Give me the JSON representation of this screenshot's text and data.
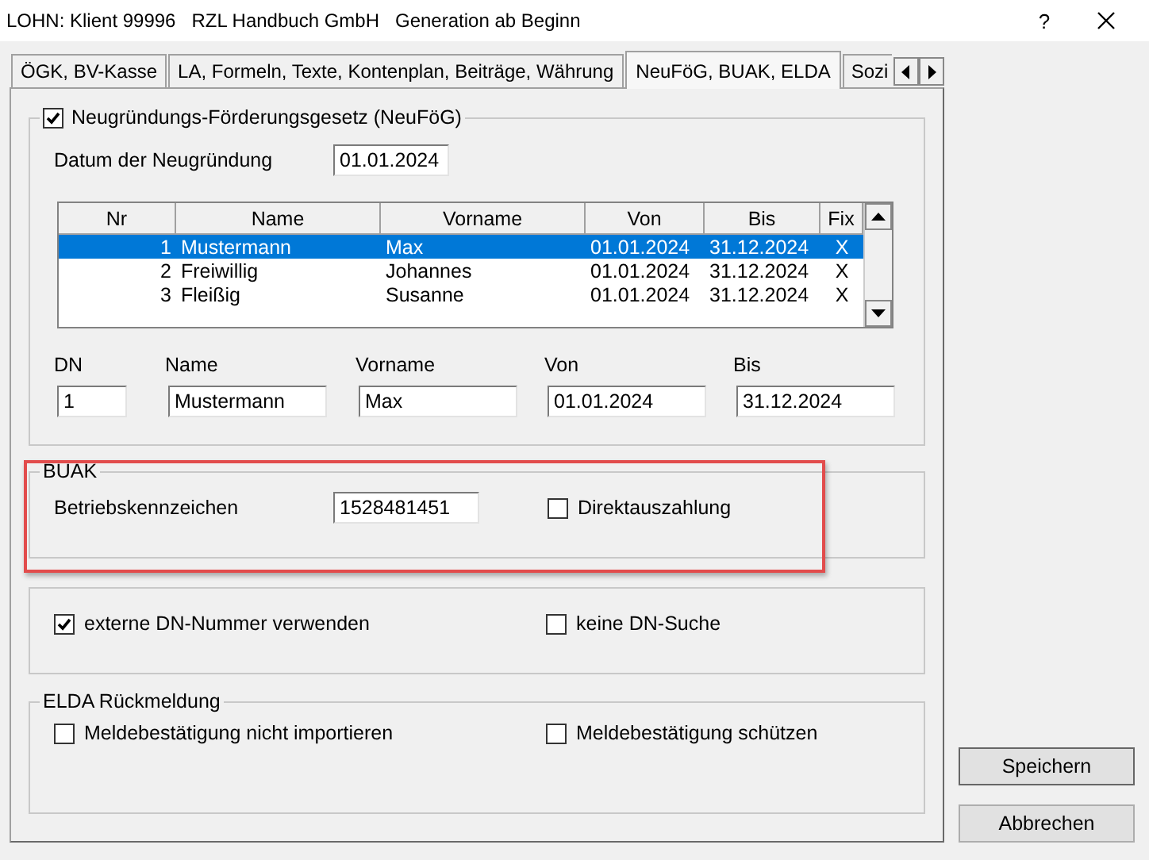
{
  "window": {
    "title": "LOHN: Klient 99996   RZL Handbuch GmbH   Generation ab Beginn",
    "help": "?"
  },
  "tabs": [
    {
      "label": "ÖGK, BV-Kasse",
      "selected": false
    },
    {
      "label": "LA, Formeln, Texte, Kontenplan, Beiträge, Währung",
      "selected": false
    },
    {
      "label": "NeuFöG, BUAK, ELDA",
      "selected": true
    },
    {
      "label": "Sozi",
      "selected": false
    }
  ],
  "neufoeg": {
    "title": "Neugründungs-Förderungsgesetz (NeuFöG)",
    "checked": true,
    "date_label": "Datum der Neugründung",
    "date_value": "01.01.2024",
    "columns": [
      "Nr",
      "Name",
      "Vorname",
      "Von",
      "Bis",
      "Fix"
    ],
    "rows": [
      {
        "cells": [
          "1",
          "Mustermann",
          "Max",
          "01.01.2024",
          "31.12.2024",
          "X"
        ],
        "selected": true
      },
      {
        "cells": [
          "2",
          "Freiwillig",
          "Johannes",
          "01.01.2024",
          "31.12.2024",
          "X"
        ],
        "selected": false
      },
      {
        "cells": [
          "3",
          "Fleißig",
          "Susanne",
          "01.01.2024",
          "31.12.2024",
          "X"
        ],
        "selected": false
      }
    ],
    "fields": [
      {
        "label": "DN",
        "value": "1"
      },
      {
        "label": "Name",
        "value": "Mustermann"
      },
      {
        "label": "Vorname",
        "value": "Max"
      },
      {
        "label": "Von",
        "value": "01.01.2024"
      },
      {
        "label": "Bis",
        "value": "31.12.2024"
      }
    ]
  },
  "buak": {
    "title": "BUAK",
    "highlighted": true,
    "field_label": "Betriebskennzeichen",
    "field_value": "1528481451",
    "checkbox": {
      "label": "Direktauszahlung",
      "checked": false
    }
  },
  "options": {
    "checkboxes": [
      {
        "label": "externe DN-Nummer verwenden",
        "checked": true
      },
      {
        "label": "keine DN-Suche",
        "checked": false
      }
    ]
  },
  "elda": {
    "title": "ELDA Rückmeldung",
    "checkboxes": [
      {
        "label": "Meldebestätigung nicht importieren",
        "checked": false
      },
      {
        "label": "Meldebestätigung schützen",
        "checked": false
      }
    ]
  },
  "buttons": [
    "Speichern",
    "Abbrechen"
  ]
}
